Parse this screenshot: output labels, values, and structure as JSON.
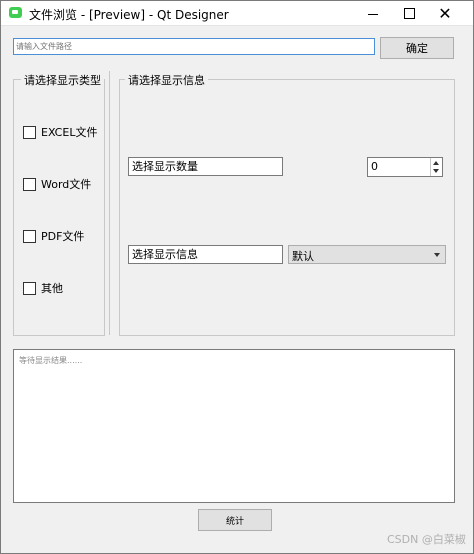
{
  "window": {
    "title": "文件浏览 - [Preview] - Qt Designer",
    "controls": {
      "minimize": "minimize",
      "maximize": "maximize",
      "close": "✕"
    }
  },
  "path_input": {
    "placeholder": "请输入文件路径"
  },
  "ok_button": {
    "label": "确定"
  },
  "type_group": {
    "title": "请选择显示类型",
    "options": [
      {
        "label": "EXCEL文件",
        "checked": false
      },
      {
        "label": "Word文件",
        "checked": false
      },
      {
        "label": "PDF文件",
        "checked": false
      },
      {
        "label": "其他",
        "checked": false
      }
    ]
  },
  "info_group": {
    "title": "请选择显示信息",
    "count_label": "选择显示数量",
    "count_value": "0",
    "info_label": "选择显示信息",
    "info_select": "默认"
  },
  "result_area": {
    "placeholder": "等待显示结果......"
  },
  "count_button": {
    "label": "统计"
  },
  "watermark": "CSDN @白菜椒"
}
